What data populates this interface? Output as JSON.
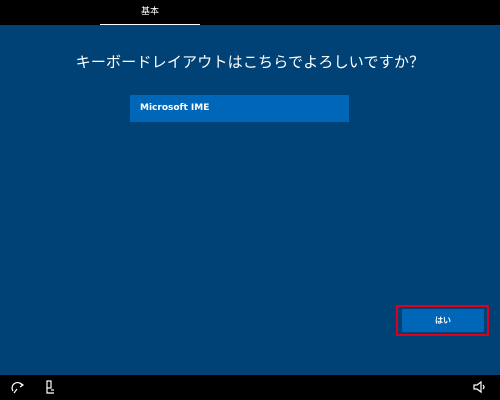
{
  "header": {
    "tab_label": "基本"
  },
  "main": {
    "title": "キーボードレイアウトはこちらでよろしいですか？",
    "layouts": [
      {
        "label": "Microsoft IME",
        "selected": true
      }
    ],
    "yes_button_label": "はい"
  },
  "bottom_bar": {
    "icons": [
      "ease-of-access-icon",
      "accessibility-person-icon",
      "volume-icon"
    ]
  },
  "colors": {
    "background": "#004275",
    "accent": "#0067b8",
    "highlight_border": "#e0001a",
    "bars": "#000000"
  }
}
